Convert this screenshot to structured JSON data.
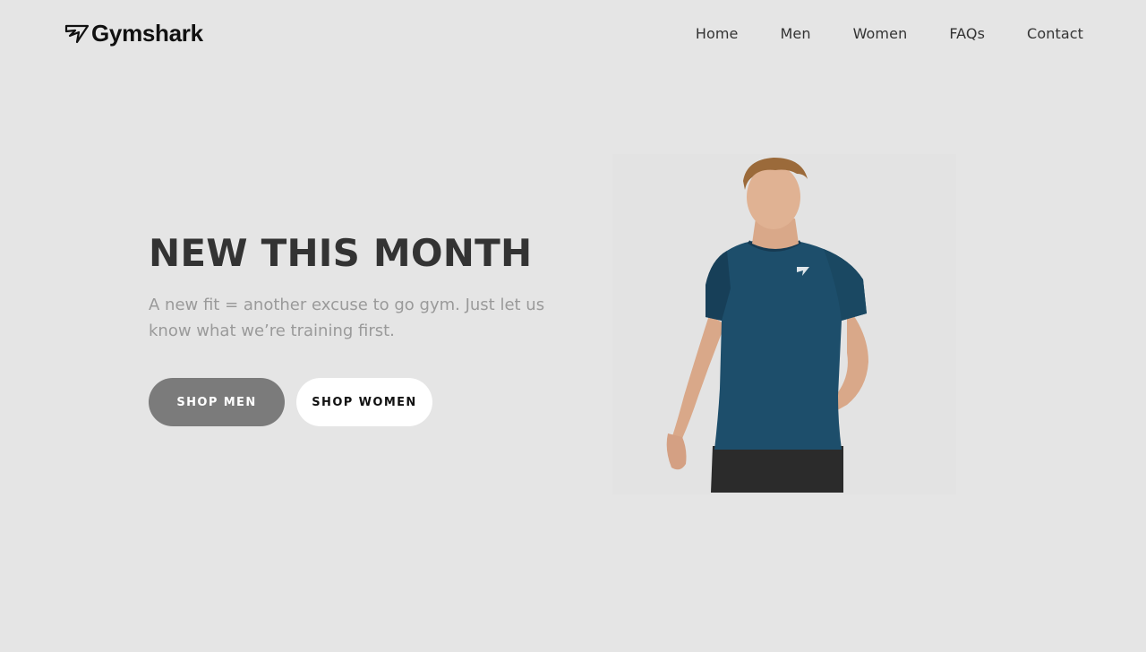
{
  "brand": {
    "name": "Gymshark",
    "logo_icon": "gymshark-shark-icon"
  },
  "nav": {
    "items": [
      {
        "label": "Home"
      },
      {
        "label": "Men"
      },
      {
        "label": "Women"
      },
      {
        "label": "FAQs"
      },
      {
        "label": "Contact"
      }
    ]
  },
  "hero": {
    "title": "NEW THIS MONTH",
    "subtitle": "A new fit = another excuse to go gym. Just let us know what we’re training first.",
    "buttons": {
      "shop_men": "SHOP MEN",
      "shop_women": "SHOP WOMEN"
    }
  },
  "colors": {
    "background": "#e5e5e5",
    "text_dark": "#333333",
    "text_muted": "#9a9a9a",
    "button_primary": "#7b7b7b",
    "button_secondary": "#ffffff",
    "shirt": "#1d4e6b"
  }
}
